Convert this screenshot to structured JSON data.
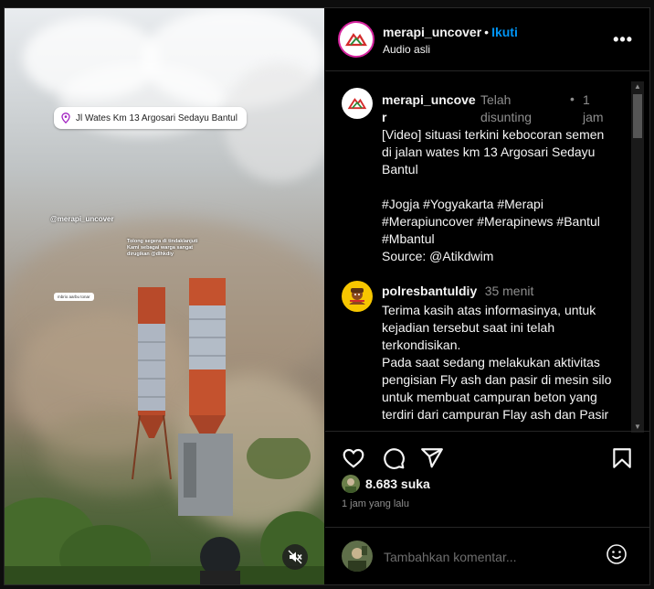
{
  "media": {
    "location_label": "Jl Wates Km 13 Argosari Sedayu Bantul",
    "watermark": "@merapi_uncover",
    "overlay_note": "Tolong segera di tindaklanjuti Kami sebagai warga sangat dirugikan @dlhkdiy",
    "tiny_tag": "mbrio aarbu tonar",
    "mute_icon": "speaker-muted-icon"
  },
  "header": {
    "username": "merapi_uncover",
    "separator": "•",
    "follow_label": "Ikuti",
    "audio_label": "Audio asli",
    "more_label": "•••"
  },
  "caption": {
    "username": "merapi_uncove r",
    "edited_label": "Telah disunting",
    "dot": "•",
    "age": "1 jam",
    "text": "[Video] situasi terkini kebocoran semen di jalan wates km 13 Argosari Sedayu Bantul\n\n#Jogja #Yogyakarta #Merapi #Merapiuncover #Merapinews #Bantul #Mbantul\nSource: @Atikdwim"
  },
  "comment": {
    "username": "polresbantuldiy",
    "age": "35 menit",
    "text": "Terima kasih atas informasinya, untuk kejadian tersebut saat ini telah terkondisikan.\nPada saat sedang melakukan aktivitas pengisian Fly ash dan pasir di mesin silo untuk membuat campuran beton yang terdiri dari campuran Flay ash dan Pasir"
  },
  "actions": {
    "like_icon": "heart-icon",
    "comment_icon": "comment-icon",
    "share_icon": "send-icon",
    "save_icon": "bookmark-icon"
  },
  "likes": {
    "count_text": "8.683 suka"
  },
  "timestamp": "1 jam yang lalu",
  "add_comment": {
    "placeholder": "Tambahkan komentar..."
  },
  "colors": {
    "follow": "#0095f6",
    "background": "#000000",
    "muted": "#8e8e8e",
    "badge_yellow": "#f7c600"
  }
}
